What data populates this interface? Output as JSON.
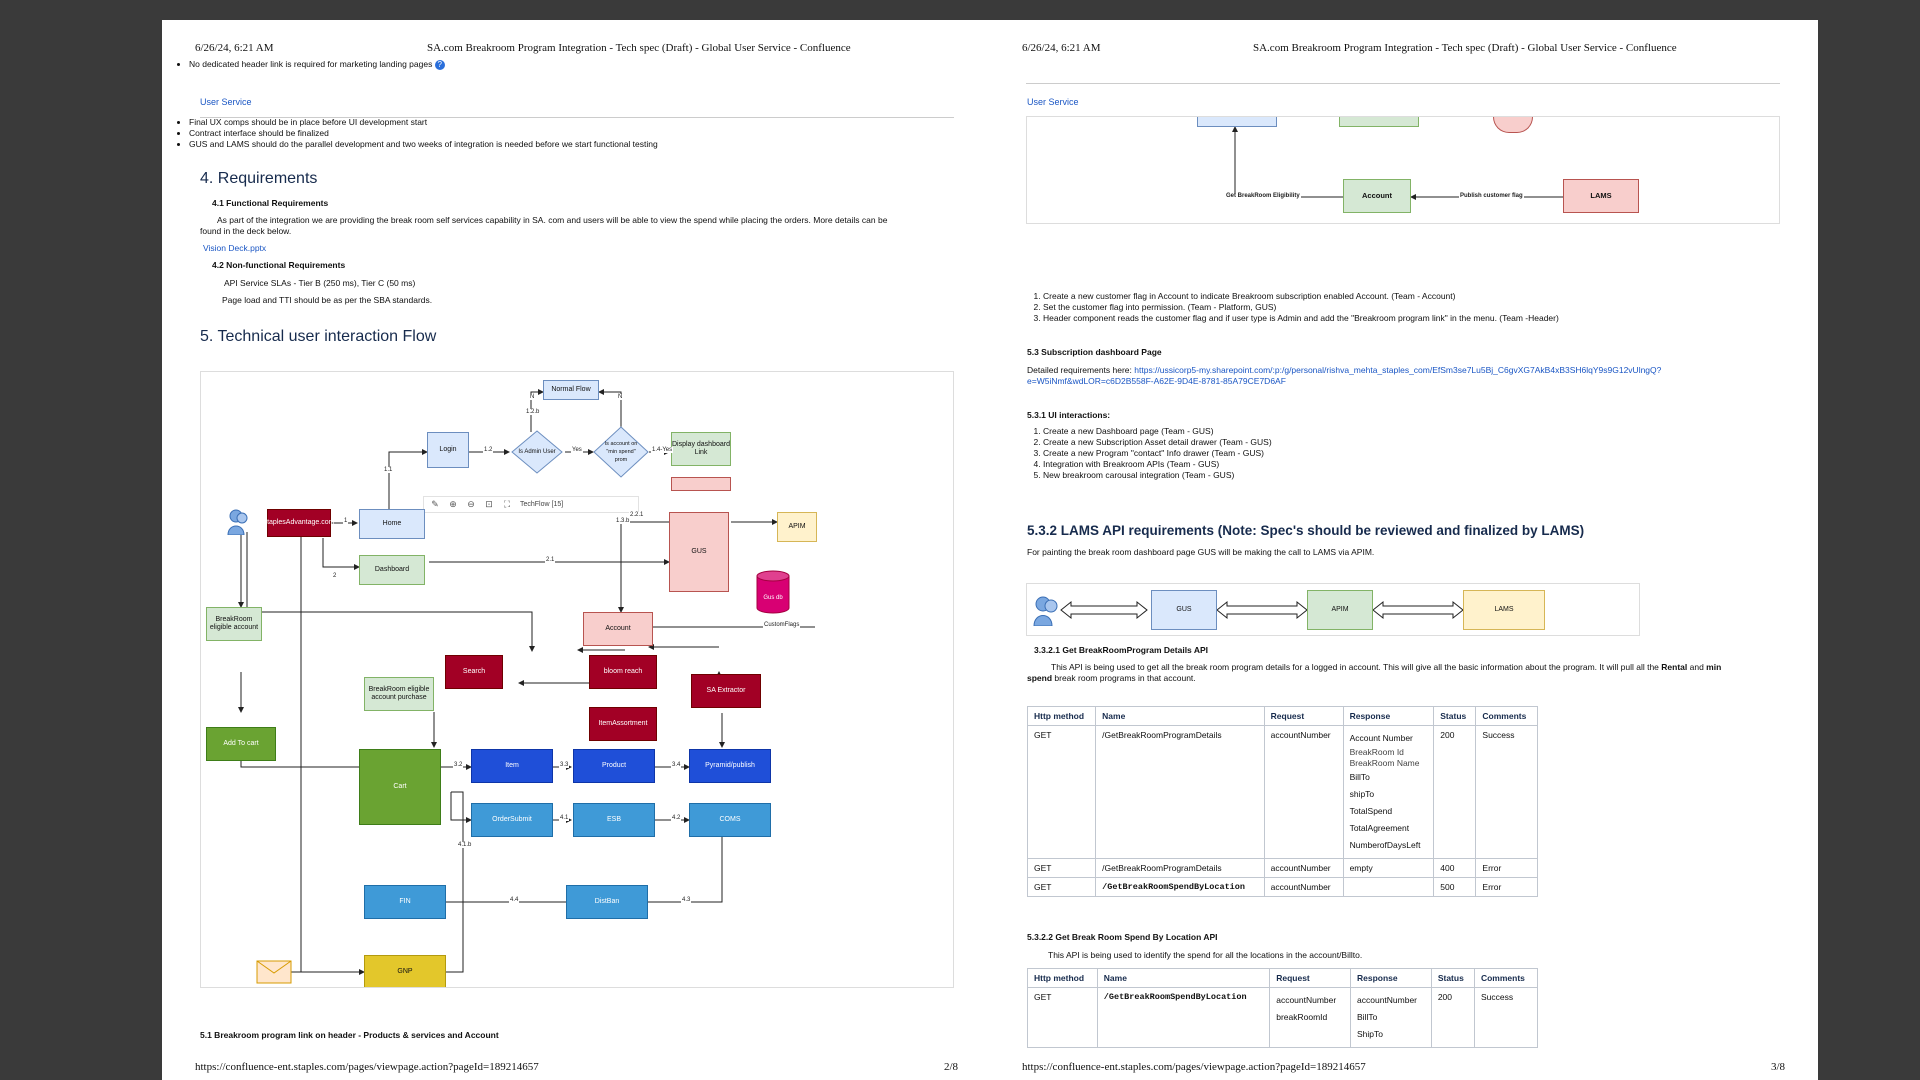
{
  "left_page": {
    "header_date": "6/26/24, 6:21 AM",
    "header_title": "SA.com Breakroom Program Integration - Tech spec (Draft) - Global User Service - Confluence",
    "top_bullet": "No dedicated header link is required for marketing landing pages",
    "user_service_link": "User Service",
    "bullets": [
      "Final UX comps should be in place before UI development start",
      "Contract interface should be finalized",
      "GUS and LAMS should do the parallel development  and two weeks of integration is needed before we start functional testing"
    ],
    "requirements_heading": "4. Requirements",
    "functional_heading": "4.1 Functional Requirements",
    "functional_text_1": "As part of the integration we are providing the break room self services capability in SA. com and users will be able to view the spend while placing the orders. More details can be",
    "functional_text_2": "found in the deck below.",
    "vision_deck_link": "Vision Deck.pptx",
    "nonfunctional_heading": "4.2 Non-functional Requirements",
    "nonfunctional_1": "API Service SLAs - Tier B (250 ms), Tier C (50 ms)",
    "nonfunctional_2": "Page load and TTI should be as per the SBA standards.",
    "flow_heading": "5. Technical user interaction Flow",
    "toolbar_label": "TechFlow [15]",
    "diagram": {
      "nodes": {
        "normal_flow": "Normal Flow",
        "login": "Login",
        "is_admin": "Is Admin User",
        "account_in_prom": "Is account on \"min spend\" prom",
        "display_dashboard": "Display dashboard Link",
        "staples_advantage": "staplesAdvantage.com",
        "home": "Home",
        "dashboard": "Dashboard",
        "gus": "GUS",
        "apim": "APIM",
        "gus_db": "Gus db",
        "account": "Account",
        "breakroom_eligible": "BreakRoom eligible account",
        "search": "Search",
        "bloom_reach": "bloom reach",
        "item_assortment": "ItemAssortment",
        "sa_extractor": "SA Extractor",
        "breakroom_purchase": "BreakRoom eligible account purchase",
        "add_to_cart": "Add To cart",
        "cart": "Cart",
        "item": "Item",
        "product": "Product",
        "pyramid": "Pyramid/publish",
        "order_submit": "OrderSubmit",
        "esb": "ESB",
        "coms": "COMS",
        "fin": "FIN",
        "distrib": "DistBan",
        "gnp": "GNP"
      },
      "edge_labels": {
        "e11": "1.1",
        "e12": "1.2",
        "e12b": "1.2.b",
        "eyes": "Yes",
        "e14": "1.4-Yes",
        "eN1": "N",
        "eN2": "N",
        "e1": "1",
        "e2": "2",
        "e21": "2.1",
        "e13b": "1.3.b",
        "e221": "2.2.1",
        "custom_flags": "CustomFlags",
        "e32": "3.2",
        "e33": "3.3",
        "e34": "3.4",
        "e41": "4.1",
        "e42": "4.2",
        "e41b": "4.1.b",
        "e43": "4.3",
        "e44": "4.4"
      }
    },
    "section_51": "5.1 Breakroom program link on header - Products & services and Account",
    "footer_url": "https://confluence-ent.staples.com/pages/viewpage.action?pageId=189214657",
    "footer_page": "2/8"
  },
  "right_page": {
    "header_date": "6/26/24, 6:21 AM",
    "header_title": "SA.com Breakroom Program Integration - Tech spec (Draft) - Global User Service - Confluence",
    "user_service_link": "User Service",
    "top_diagram": {
      "get_eligibility": "Get BreakRoom Eligibility",
      "account": "Account",
      "publish_flag": "Publish customer flag",
      "lams": "LAMS"
    },
    "steps": [
      "Create a new customer flag in Account to indicate Breakroom subscription enabled Account. (Team - Account)",
      "Set the customer flag into permission. (Team - Platform, GUS)",
      "Header component reads the customer flag and if user type is Admin and add the \"Breakroom program link\" in the menu. (Team -Header)"
    ],
    "section_53": "5.3 Subscription dashboard Page",
    "detailed_req_prefix": "Detailed requirements here:",
    "detailed_req_link_1": "https://ussicorp5-my.sharepoint.com/:p:/g/personal/rishva_mehta_staples_com/EfSm3se7Lu5Bj_C6gvXG7AkB4xB3SH6lqY9s9G12vUlngQ?",
    "detailed_req_link_2": "e=W5iNmf&wdLOR=c6D2B558F-A62E-9D4E-8781-85A79CE7D6AF",
    "section_531": "5.3.1 UI interactions:",
    "ui_steps": [
      "Create a new Dashboard page (Team - GUS)",
      "Create a new Subscription Asset detail drawer (Team - GUS)",
      "Create a new Program \"contact\" Info drawer (Team - GUS)",
      "Integration with Breakroom APIs (Team - GUS)",
      "New breakroom carousal integration (Team - GUS)"
    ],
    "section_532": "5.3.2 LAMS API requirements (Note: Spec's should be reviewed and finalized by LAMS)",
    "lams_intro": "For painting the break room dashboard page GUS will be making the call to LAMS via APIM.",
    "flow_nodes": {
      "gus": "GUS",
      "apim": "APIM",
      "lams": "LAMS"
    },
    "section_5321": "3.3.2.1  Get BreakRoomProgram Details API",
    "details_text_1_a": "This API is being used to get all the break room program details for a logged in account. This will give all the basic information about the program. It will pull all the ",
    "details_text_1_b": "Rental",
    "details_text_1_c": " and ",
    "details_text_1_d": "min",
    "details_text_2_a": "spend",
    "details_text_2_b": " break room programs in that account.",
    "table1": {
      "headers": [
        "Http method",
        "Name",
        "Request",
        "Response",
        "Status",
        "Comments"
      ],
      "rows": [
        {
          "method": "GET",
          "name": "/GetBreakRoomProgramDetails",
          "request": "accountNumber",
          "response": [
            "Account Number",
            "BreakRoom Id\nBreakRoom Name",
            "BillTo",
            "shipTo",
            "TotalSpend",
            "TotalAgreement",
            "NumberofDaysLeft"
          ],
          "status": "200",
          "comments": "Success"
        },
        {
          "method": "GET",
          "name": "/GetBreakRoomProgramDetails",
          "request": "accountNumber",
          "response": [
            "empty"
          ],
          "status": "400",
          "comments": "Error"
        },
        {
          "method": "GET",
          "name": "/GetBreakRoomSpendByLocation",
          "request": "accountNumber",
          "response": [
            ""
          ],
          "status": "500",
          "comments": "Error"
        }
      ]
    },
    "section_5322": "5.3.2.2  Get Break Room Spend By Location API",
    "spend_text": "This API is being used to identify the spend for all the locations in the account/Billto.",
    "table2": {
      "headers": [
        "Http method",
        "Name",
        "Request",
        "Response",
        "Status",
        "Comments"
      ],
      "rows": [
        {
          "method": "GET",
          "name": "/GetBreakRoomSpendByLocation",
          "request": [
            "accountNumber",
            "breakRoomId"
          ],
          "response": [
            "accountNumber",
            "BillTo",
            "ShipTo"
          ],
          "status": "200",
          "comments": "Success"
        }
      ]
    },
    "footer_url": "https://confluence-ent.staples.com/pages/viewpage.action?pageId=189214657",
    "footer_page": "3/8"
  }
}
